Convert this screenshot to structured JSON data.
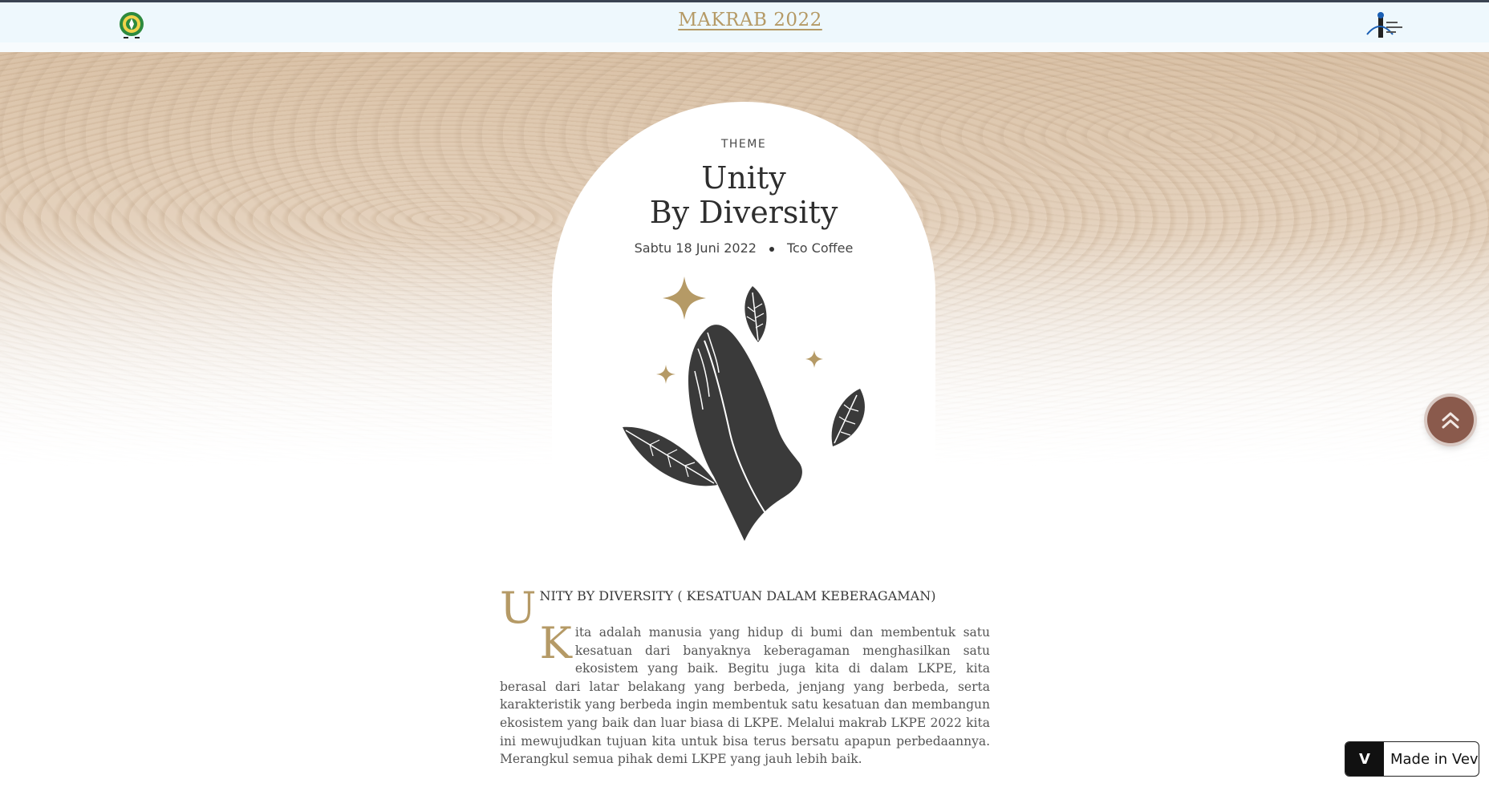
{
  "header": {
    "site_title": "MAKRAB 2022"
  },
  "hero": {
    "theme_label": "THEME",
    "theme_line1": "Unity",
    "theme_line2": "By Diversity",
    "date": "Sabtu 18 Juni 2022",
    "venue": "Tco Coffee"
  },
  "article": {
    "heading_dropcap": "U",
    "heading_rest": "NITY BY DIVERSITY ( KESATUAN DALAM KEBERAGAMAN)",
    "para_dropcap": "K",
    "para_rest": "ita adalah manusia yang hidup di bumi dan membentuk satu kesatuan dari banyaknya keberagaman menghasilkan satu ekosistem yang baik. Begitu juga kita di dalam LKPE, kita berasal dari latar belakang yang berbeda, jenjang yang berbeda, serta karakteristik yang berbeda ingin membentuk satu kesatuan dan membangun ekosistem yang baik dan luar biasa di LKPE. Melalui makrab LKPE 2022 kita ini mewujudkan tujuan kita untuk bisa terus bersatu apapun perbedaannya. Merangkul semua pihak demi LKPE yang jauh lebih baik."
  },
  "badge": {
    "logo_text": "V",
    "label": "Made in Vev"
  },
  "colors": {
    "accent_gold": "#b59a66",
    "dark_ink": "#3a3a3a",
    "scroll_button": "#8a5a4c"
  },
  "icons": {
    "scroll_top": "double-chevron-up-icon",
    "illustration": "praying-hands-illustration"
  }
}
